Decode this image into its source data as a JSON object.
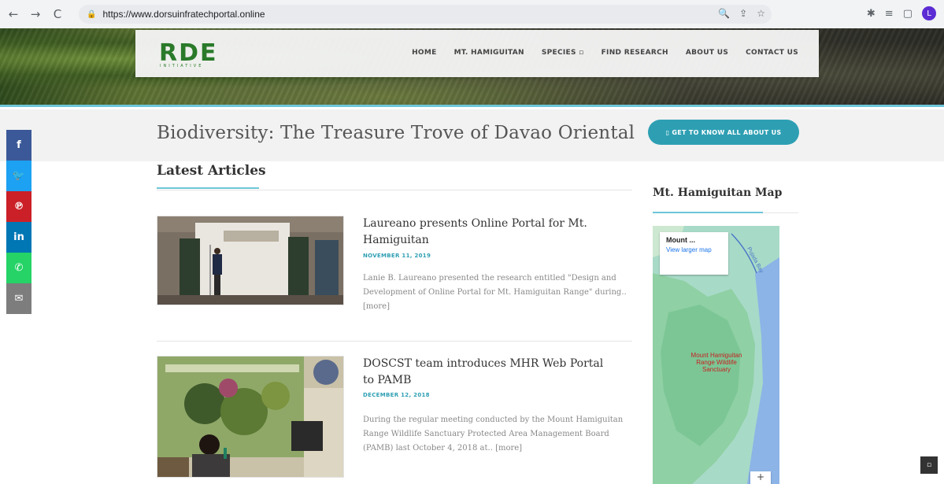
{
  "browser": {
    "back": "←",
    "forward": "→",
    "reload": "C",
    "url": "https://www.dorsuinfratechportal.online",
    "omni_icons": [
      "🔍",
      "⇪",
      "☆"
    ],
    "toolbar_icons": [
      "✱",
      "≡",
      "▢"
    ],
    "profile_initial": "L"
  },
  "header": {
    "logo_text": "RDE",
    "logo_sub": "INITIATIVE",
    "menu": [
      "HOME",
      "MT. HAMIGUITAN",
      "SPECIES ▫",
      "FIND RESEARCH",
      "ABOUT US",
      "CONTACT US"
    ]
  },
  "title_band": {
    "title": "Biodiversity: The Treasure Trove of Davao Oriental",
    "cta": "▯ GET TO KNOW ALL ABOUT US"
  },
  "social": [
    {
      "label": "f",
      "color": "#3b5998"
    },
    {
      "label": "🐦",
      "color": "#1da1f2"
    },
    {
      "label": "℗",
      "color": "#cb2027"
    },
    {
      "label": "in",
      "color": "#0077b5"
    },
    {
      "label": "✆",
      "color": "#25d366"
    },
    {
      "label": "✉",
      "color": "#7d7d7d"
    }
  ],
  "articles_section": {
    "title": "Latest Articles",
    "items": [
      {
        "title": "Laureano presents Online Portal for Mt. Hamiguitan",
        "date": "NOVEMBER 11, 2019",
        "excerpt": "Lanie B. Laureano presented the research entitled \"Design and Development of Online Portal for Mt. Hamiguitan Range\" during.. [more]"
      },
      {
        "title": "DOSCST team introduces MHR Web Portal to PAMB",
        "date": "DECEMBER 12, 2018",
        "excerpt": "During the regular meeting conducted by the Mount Hamiguitan Range Wildlife Sanctuary Protected Area Management Board (PAMB) last October 4, 2018 at.. [more]"
      }
    ]
  },
  "sidebar": {
    "map_title": "Mt. Hamiguitan Map",
    "map_card_title": "Mount ...",
    "map_card_link": "View larger map",
    "map_place": "Mount Hamiguitan Range Wildlife Sanctuary",
    "road": "Pujada Bay",
    "zoom_plus": "+"
  },
  "corner_button": "▫"
}
